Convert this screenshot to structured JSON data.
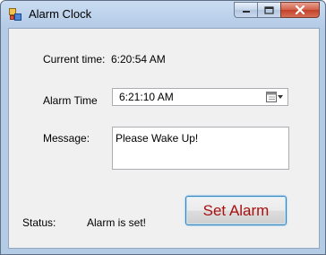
{
  "window": {
    "title": "Alarm Clock",
    "icon": "application-icon"
  },
  "caption": {
    "minimize_icon": "minimize-icon",
    "maximize_icon": "maximize-icon",
    "close_icon": "close-icon"
  },
  "form": {
    "current_time_label": "Current time:",
    "current_time_value": "6:20:54 AM",
    "alarm_time_label": "Alarm Time",
    "alarm_time_value": "6:21:10 AM",
    "message_label": "Message:",
    "message_value": "Please Wake Up!",
    "status_label": "Status:",
    "status_value": "Alarm is set!",
    "set_alarm_button": "Set Alarm"
  },
  "colors": {
    "button_text": "#a81010",
    "title_bar": "#b4cbe6",
    "close_button": "#c2412a"
  }
}
